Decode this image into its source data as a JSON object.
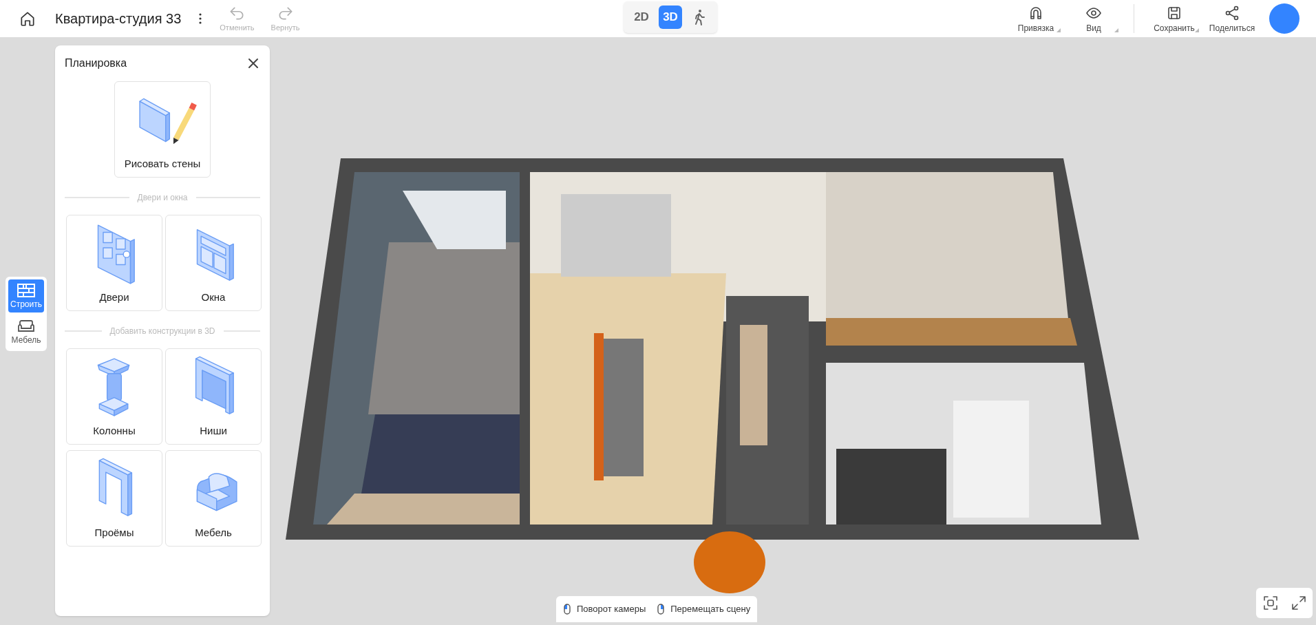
{
  "header": {
    "title": "Квартира-студия 33",
    "undo": {
      "label": "Отменить",
      "disabled": true
    },
    "redo": {
      "label": "Вернуть",
      "disabled": true
    }
  },
  "view_modes": [
    {
      "kind": "text",
      "label": "2D",
      "selected": false
    },
    {
      "kind": "text",
      "label": "3D",
      "selected": true
    },
    {
      "kind": "walk",
      "selected": false
    }
  ],
  "toolbar": [
    {
      "label": "Привязка",
      "dropdown": true
    },
    {
      "label": "Вид",
      "dropdown": true
    },
    {
      "label": "Сохранить",
      "dropdown": true
    },
    {
      "label": "Поделиться",
      "dropdown": false
    }
  ],
  "rail": [
    {
      "label": "Строить",
      "selected": true
    },
    {
      "label": "Мебель",
      "selected": false
    }
  ],
  "panel": {
    "title": "Планировка",
    "primary": {
      "label": "Рисовать стены"
    },
    "sections": [
      {
        "title": "Двери и окна",
        "items": [
          {
            "label": "Двери"
          },
          {
            "label": "Окна"
          }
        ]
      },
      {
        "title": "Добавить конструкции в 3D",
        "items": [
          {
            "label": "Колонны"
          },
          {
            "label": "Ниши"
          },
          {
            "label": "Проёмы"
          },
          {
            "label": "Мебель"
          }
        ]
      }
    ]
  },
  "hints": [
    {
      "label": "Поворот камеры"
    },
    {
      "label": "Перемещать сцену"
    }
  ]
}
